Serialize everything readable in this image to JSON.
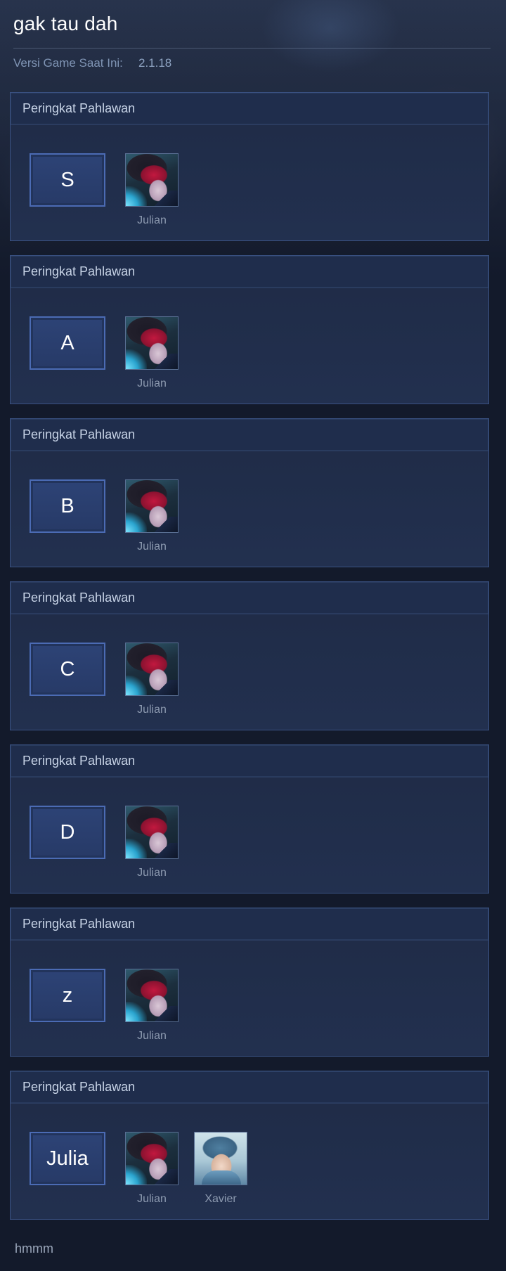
{
  "header": {
    "title": "gak tau dah",
    "version_label": "Versi Game Saat Ini:",
    "version_value": "2.1.18"
  },
  "tier_lists": [
    {
      "header": "Peringkat Pahlawan",
      "tier": "S",
      "heroes": [
        {
          "name": "Julian",
          "portrait": "julian-portrait"
        }
      ]
    },
    {
      "header": "Peringkat Pahlawan",
      "tier": "A",
      "heroes": [
        {
          "name": "Julian",
          "portrait": "julian-portrait"
        }
      ]
    },
    {
      "header": "Peringkat Pahlawan",
      "tier": "B",
      "heroes": [
        {
          "name": "Julian",
          "portrait": "julian-portrait"
        }
      ]
    },
    {
      "header": "Peringkat Pahlawan",
      "tier": "C",
      "heroes": [
        {
          "name": "Julian",
          "portrait": "julian-portrait"
        }
      ]
    },
    {
      "header": "Peringkat Pahlawan",
      "tier": "D",
      "heroes": [
        {
          "name": "Julian",
          "portrait": "julian-portrait"
        }
      ]
    },
    {
      "header": "Peringkat Pahlawan",
      "tier": "z",
      "heroes": [
        {
          "name": "Julian",
          "portrait": "julian-portrait"
        }
      ]
    },
    {
      "header": "Peringkat Pahlawan",
      "tier": "Julia",
      "heroes": [
        {
          "name": "Julian",
          "portrait": "julian-portrait"
        },
        {
          "name": "Xavier",
          "portrait": "xavier-portrait"
        }
      ]
    }
  ],
  "footer": {
    "text": "hmmm"
  },
  "colors": {
    "card_border": "#3a5283",
    "tier_border": "#4b6bb4",
    "background": "#131a2b"
  }
}
